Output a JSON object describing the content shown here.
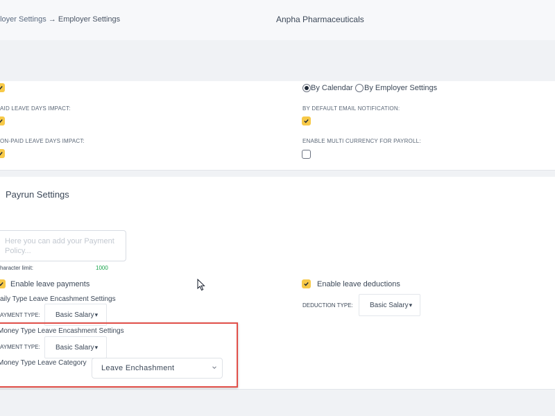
{
  "header": {
    "breadcrumb_parent": "ployer Settings",
    "breadcrumb_arrow": "→",
    "breadcrumb_current": "Employer Settings",
    "company_name": "Anpha Pharmaceuticals"
  },
  "leave_settings": {
    "top_checkbox_checked": true,
    "radio_options": [
      {
        "label": "By Calendar",
        "selected": true
      },
      {
        "label": "By Employer Settings",
        "selected": false
      }
    ],
    "paid_leave_label": "AID LEAVE DAYS IMPACT:",
    "paid_leave_checked": true,
    "email_notification_label": "BY DEFAULT EMAIL NOTIFICATION:",
    "email_notification_checked": true,
    "non_paid_label": "ON-PAID LEAVE DAYS IMPACT:",
    "non_paid_checked": true,
    "multi_currency_label": "ENABLE MULTI CURRENCY FOR PAYROLL:",
    "multi_currency_checked": false
  },
  "payrun": {
    "title": "Payrun Settings",
    "policy_placeholder": "Here you can add your Payment Policy...",
    "character_limit_label": "haracter limit:",
    "character_limit_value": "1000",
    "enable_leave_payments_label": "Enable leave payments",
    "enable_leave_payments_checked": true,
    "enable_leave_deductions_label": "Enable leave deductions",
    "enable_leave_deductions_checked": true,
    "daily_encashment_title": "aily Type Leave Encashment Settings",
    "daily_payment_type_label": "AYMENT TYPE:",
    "daily_payment_type_value": "Basic Salary",
    "deduction_type_label": "DEDUCTION TYPE:",
    "deduction_type_value": "Basic Salary",
    "money_encashment_title": "Money Type Leave Encashment Settings",
    "money_payment_type_label": "AYMENT TYPE:",
    "money_payment_type_value": "Basic Salary",
    "money_leave_category_label": "Money Type Leave Category",
    "money_leave_category_value": "Leave Enchashment",
    "dropdown_arrow": "▾"
  },
  "colors": {
    "accent_yellow": "#f7c948",
    "highlight_red": "#e2504a",
    "limit_green": "#16a34a"
  }
}
